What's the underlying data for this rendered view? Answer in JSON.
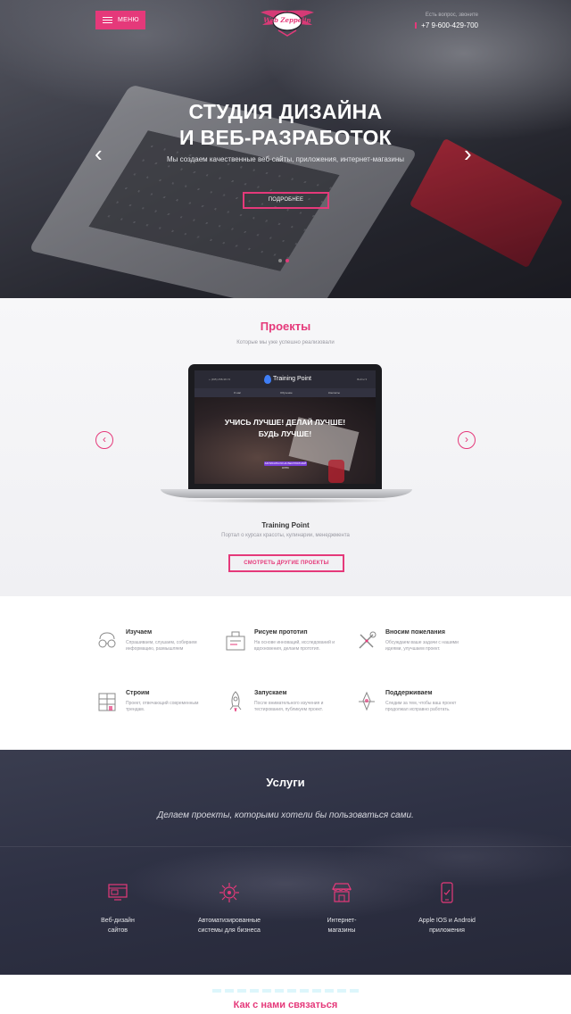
{
  "header": {
    "menu_label": "МЕНЮ",
    "logo_text": "Web Zeppeliп",
    "contact_question": "Есть вопрос, звоните",
    "phone": "+7 9-600-429-700"
  },
  "hero": {
    "title_line1": "СТУДИЯ ДИЗАЙНА",
    "title_line2": "И ВЕБ-РАЗРАБОТОК",
    "subtitle": "Мы создаем качественные веб-сайты, приложения, интернет-магазины",
    "button_label": "ПОДРОБНЕЕ",
    "slides_total": 2,
    "slide_active": 2
  },
  "projects": {
    "title": "Проекты",
    "subtitle": "Которые мы уже успешно реализовали",
    "screen": {
      "brand": "Training Point",
      "phone": "+ (495) 258-38-74",
      "right_link": "Войти ▾",
      "nav": [
        "О нас",
        "Обучение",
        "Контакты"
      ],
      "headline_line1": "УЧИСЬ ЛУЧШЕ! ДЕЛАЙ ЛУЧШЕ!",
      "headline_line2": "БУДЬ ЛУЧШЕ!",
      "cta": "ЗАПИСАТЬСЯ НА БЕСПЛАТНЫЙ КУРС"
    },
    "project_name": "Training Point",
    "project_desc": "Портал о курсах красоты, кулинарии, менеджмента",
    "button_label": "СМОТРЕТЬ ДРУГИЕ ПРОЕКТЫ"
  },
  "process": [
    {
      "title": "Изучаем",
      "desc": "Спрашиваем, слушаем, собираем информацию, размышляем",
      "icon": "glasses-icon"
    },
    {
      "title": "Рисуем прототип",
      "desc": "На основе инноваций, исследований и вдохновения, делаем прототип.",
      "icon": "prototype-icon"
    },
    {
      "title": "Вносим пожелания",
      "desc": "Обсуждаем ваше задачи с нашими идеями, улучшаем проект.",
      "icon": "tools-icon"
    },
    {
      "title": "Строим",
      "desc": "Проект, отвечающий современным трендам.",
      "icon": "building-icon"
    },
    {
      "title": "Запускаем",
      "desc": "После внимательного изучения и тестирования, публикуем проект.",
      "icon": "rocket-icon"
    },
    {
      "title": "Поддерживаем",
      "desc": "Следим за тем, чтобы ваш проект продолжал исправно работать.",
      "icon": "support-icon"
    }
  ],
  "services": {
    "title": "Услуги",
    "tagline": "Делаем проекты, которыми хотели бы пользоваться сами.",
    "items": [
      {
        "line1": "Веб-дизайн",
        "line2": "сайтов",
        "icon": "web-design-icon"
      },
      {
        "line1": "Автоматизированные",
        "line2": "системы для бизнеса",
        "icon": "automation-icon"
      },
      {
        "line1": "Интернет-",
        "line2": "магазины",
        "icon": "store-icon"
      },
      {
        "line1": "Apple IOS и Android",
        "line2": "приложения",
        "icon": "mobile-app-icon"
      }
    ]
  },
  "contact": {
    "title": "Как с нами связаться"
  },
  "colors": {
    "accent": "#e5397a",
    "dark_bg": "#2e3144"
  }
}
